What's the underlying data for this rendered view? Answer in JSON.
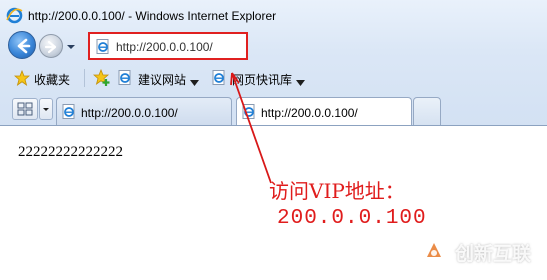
{
  "window": {
    "title": "http://200.0.0.100/ - Windows Internet Explorer"
  },
  "navigation": {
    "address": "http://200.0.0.100/",
    "back_icon": "back-arrow-icon",
    "forward_icon": "forward-arrow-icon"
  },
  "favorites_bar": {
    "favorites_label": "收藏夹",
    "suggested_sites_label": "建议网站",
    "web_slice_gallery_label": "网页快讯库"
  },
  "tabs": [
    {
      "label": "http://200.0.0.100/",
      "active": false
    },
    {
      "label": "http://200.0.0.100/",
      "active": true
    }
  ],
  "page": {
    "body_text": "22222222222222"
  },
  "annotation": {
    "line1": "访问VIP地址：",
    "line2": "200.0.0.100",
    "color": "#e01c1c"
  },
  "watermark": {
    "text": "创新互联"
  },
  "colors": {
    "chrome_top": "#e9f1fb",
    "chrome_bottom": "#d3e1f3",
    "highlight_red": "#e02020"
  }
}
